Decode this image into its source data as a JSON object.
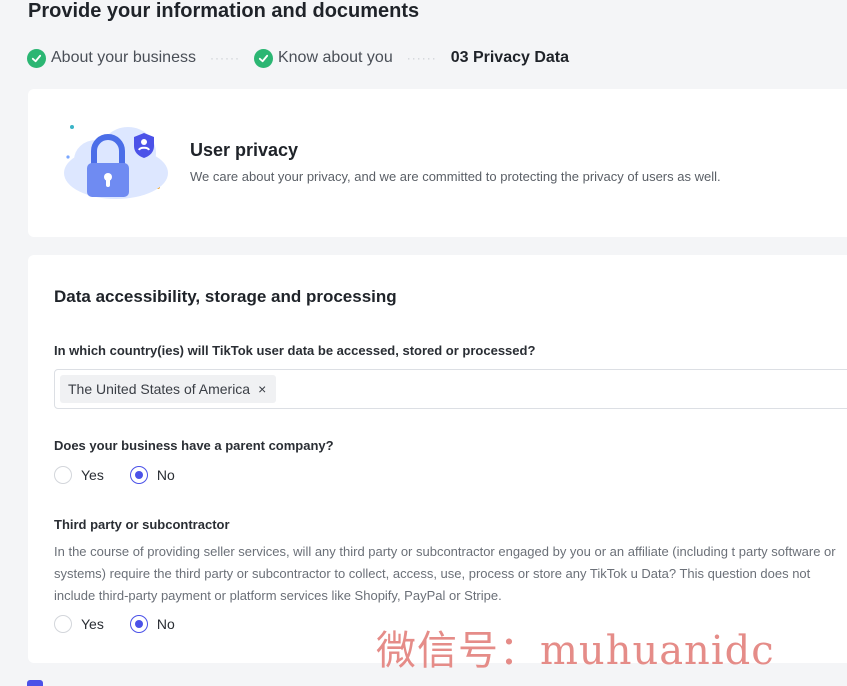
{
  "page": {
    "title": "Provide your information and documents"
  },
  "stepper": {
    "steps": [
      {
        "label": "About your business",
        "status": "done"
      },
      {
        "label": "Know about you",
        "status": "done"
      },
      {
        "label": "03 Privacy Data",
        "status": "active"
      }
    ],
    "separator": "······"
  },
  "privacy_card": {
    "title": "User privacy",
    "description": "We care about your privacy, and we are committed to protecting the privacy of users as well."
  },
  "data_section": {
    "title": "Data accessibility, storage and processing",
    "country_question": "In which country(ies) will TikTok user data be accessed, stored or processed?",
    "selected_country": "The United States of America",
    "remove_symbol": "×",
    "parent_question": "Does your business have a parent company?",
    "parent_options": [
      "Yes",
      "No"
    ],
    "parent_selected": "No",
    "third_party_title": "Third party or subcontractor",
    "third_party_description": "In the course of providing seller services, will any third party or subcontractor engaged by you or an affiliate (including t party software or systems) require the third party or subcontractor to collect, access, use, process or store any TikTok u Data? This question does not include third-party payment or platform services like Shopify, PayPal or Stripe.",
    "third_party_options": [
      "Yes",
      "No"
    ],
    "third_party_selected": "No"
  },
  "watermark": "微信号：muhuanidc",
  "colors": {
    "accent": "#4b52e8",
    "success": "#2bb673",
    "background": "#f4f5f7",
    "watermark": "#e58c88"
  }
}
